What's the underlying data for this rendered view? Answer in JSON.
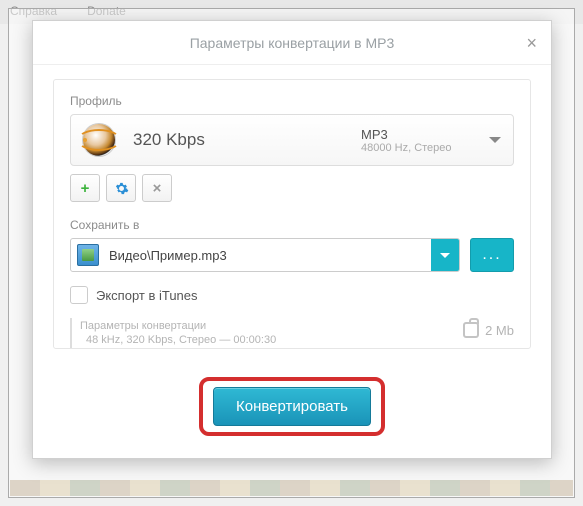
{
  "menu": {
    "help": "Справка",
    "donate": "Donate"
  },
  "dialog": {
    "title": "Параметры конвертации в MP3",
    "profile_label": "Профиль",
    "profile": {
      "bitrate": "320 Kbps",
      "format": "MP3",
      "details": "48000 Hz,  Стерео"
    },
    "save_label": "Сохранить в",
    "save_path": "Видео\\Пример.mp3",
    "browse_label": "...",
    "export_itunes": "Экспорт в iTunes",
    "summary_title": "Параметры конвертации",
    "summary_line": "48 kHz, 320 Kbps, Стерео — 00:00:30",
    "size": "2 Mb",
    "convert": "Конвертировать"
  }
}
